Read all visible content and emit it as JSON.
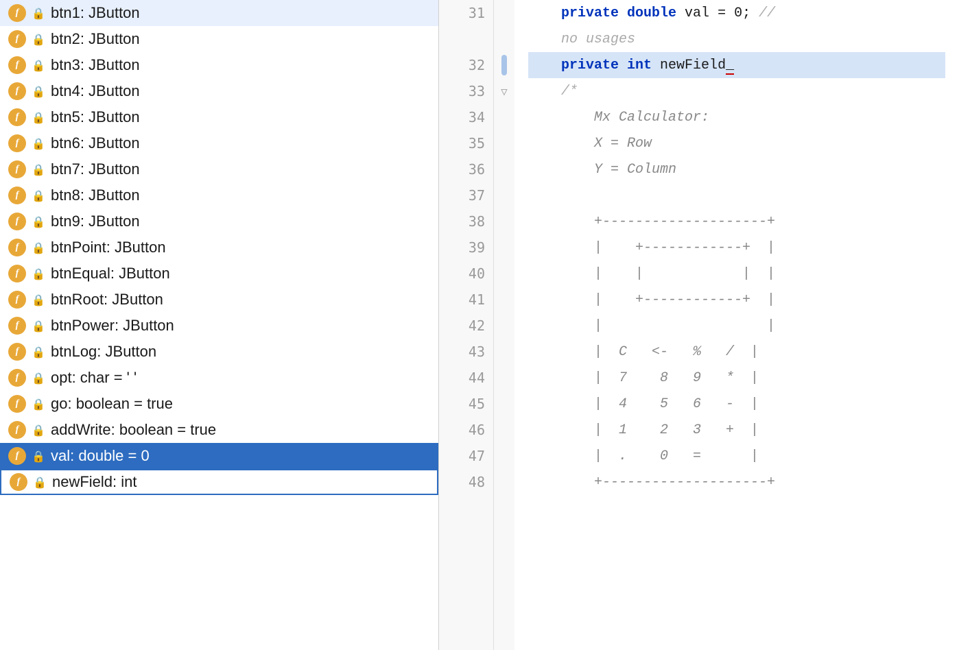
{
  "fields": [
    {
      "id": 1,
      "label": "btn1: JButton",
      "selected": false,
      "highlighted": false
    },
    {
      "id": 2,
      "label": "btn2: JButton",
      "selected": false,
      "highlighted": false
    },
    {
      "id": 3,
      "label": "btn3: JButton",
      "selected": false,
      "highlighted": false
    },
    {
      "id": 4,
      "label": "btn4: JButton",
      "selected": false,
      "highlighted": false
    },
    {
      "id": 5,
      "label": "btn5: JButton",
      "selected": false,
      "highlighted": false
    },
    {
      "id": 6,
      "label": "btn6: JButton",
      "selected": false,
      "highlighted": false
    },
    {
      "id": 7,
      "label": "btn7: JButton",
      "selected": false,
      "highlighted": false
    },
    {
      "id": 8,
      "label": "btn8: JButton",
      "selected": false,
      "highlighted": false
    },
    {
      "id": 9,
      "label": "btn9: JButton",
      "selected": false,
      "highlighted": false
    },
    {
      "id": 10,
      "label": "btnPoint: JButton",
      "selected": false,
      "highlighted": false
    },
    {
      "id": 11,
      "label": "btnEqual: JButton",
      "selected": false,
      "highlighted": false
    },
    {
      "id": 12,
      "label": "btnRoot: JButton",
      "selected": false,
      "highlighted": false
    },
    {
      "id": 13,
      "label": "btnPower: JButton",
      "selected": false,
      "highlighted": false
    },
    {
      "id": 14,
      "label": "btnLog: JButton",
      "selected": false,
      "highlighted": false
    },
    {
      "id": 15,
      "label": "opt: char = ' '",
      "selected": false,
      "highlighted": false
    },
    {
      "id": 16,
      "label": "go: boolean = true",
      "selected": false,
      "highlighted": false
    },
    {
      "id": 17,
      "label": "addWrite: boolean = true",
      "selected": false,
      "highlighted": false
    },
    {
      "id": 18,
      "label": "val: double = 0",
      "selected": true,
      "highlighted": false
    },
    {
      "id": 19,
      "label": "newField: int",
      "selected": false,
      "highlighted": true
    }
  ],
  "codeLines": [
    {
      "lineNum": 31,
      "content": "    private double val = 0; //",
      "type": "code",
      "hasScrollbar": false
    },
    {
      "lineNum": null,
      "content": "    no usages",
      "type": "comment-only",
      "hasScrollbar": false
    },
    {
      "lineNum": 32,
      "content": "    private int newField_",
      "type": "code-highlight",
      "hasScrollbar": true
    },
    {
      "lineNum": 33,
      "content": "    /*",
      "type": "comment-start",
      "hasScrollbar": false,
      "gutter": "▽"
    },
    {
      "lineNum": 34,
      "content": "        Mx Calculator:",
      "type": "comment-italic",
      "hasScrollbar": false
    },
    {
      "lineNum": 35,
      "content": "        X = Row",
      "type": "comment-italic",
      "hasScrollbar": false
    },
    {
      "lineNum": 36,
      "content": "        Y = Column",
      "type": "comment-italic",
      "hasScrollbar": false
    },
    {
      "lineNum": 37,
      "content": "",
      "type": "empty",
      "hasScrollbar": false
    },
    {
      "lineNum": 38,
      "content": "        +--------------------+",
      "type": "comment-ascii",
      "hasScrollbar": false
    },
    {
      "lineNum": 39,
      "content": "        |    +------------+  |",
      "type": "comment-ascii",
      "hasScrollbar": false
    },
    {
      "lineNum": 40,
      "content": "        |    |            |  |",
      "type": "comment-ascii",
      "hasScrollbar": false
    },
    {
      "lineNum": 41,
      "content": "        |    +------------+  |",
      "type": "comment-ascii",
      "hasScrollbar": false
    },
    {
      "lineNum": 42,
      "content": "        |                    |",
      "type": "comment-ascii",
      "hasScrollbar": false
    },
    {
      "lineNum": 43,
      "content": "        |  C   <-   %   /  |",
      "type": "comment-ascii",
      "hasScrollbar": false
    },
    {
      "lineNum": 44,
      "content": "        |  7    8   9   *  |",
      "type": "comment-ascii",
      "hasScrollbar": false
    },
    {
      "lineNum": 45,
      "content": "        |  4    5   6   -  |",
      "type": "comment-ascii",
      "hasScrollbar": false
    },
    {
      "lineNum": 46,
      "content": "        |  1    2   3   +  |",
      "type": "comment-ascii",
      "hasScrollbar": false
    },
    {
      "lineNum": 47,
      "content": "        |  .    0   =      |",
      "type": "comment-ascii",
      "hasScrollbar": false
    },
    {
      "lineNum": 48,
      "content": "        +--------------------+",
      "type": "comment-ascii",
      "hasScrollbar": false
    }
  ]
}
